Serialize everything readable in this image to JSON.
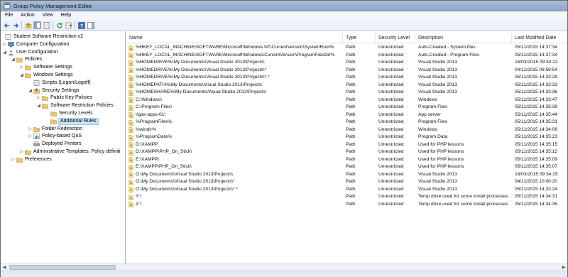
{
  "window": {
    "title": "Group Policy Management Editor"
  },
  "menu": [
    "File",
    "Action",
    "View",
    "Help"
  ],
  "colors": {
    "accent": "#2f6fb3",
    "folder": "#e8c66a",
    "selection": "#cce4f7"
  },
  "tree": [
    {
      "label": "Student Software Restriction v2",
      "icon": "gpo-icon",
      "exp": ""
    },
    {
      "label": "Computer Configuration",
      "icon": "computer-icon",
      "exp": "▷"
    },
    {
      "label": "User Configuration",
      "icon": "user-icon",
      "exp": "◢"
    },
    {
      "label": "Policies",
      "icon": "folder-icon",
      "exp": "◢"
    },
    {
      "label": "Software Settings",
      "icon": "folder-icon",
      "exp": "▷"
    },
    {
      "label": "Windows Settings",
      "icon": "folder-icon",
      "exp": "◢"
    },
    {
      "label": "Scripts (Logon/Logoff)",
      "icon": "script-icon",
      "exp": ""
    },
    {
      "label": "Security Settings",
      "icon": "security-icon",
      "exp": "◢"
    },
    {
      "label": "Public Key Policies",
      "icon": "folder-icon",
      "exp": "▷"
    },
    {
      "label": "Software Restriction Policies",
      "icon": "folder-icon",
      "exp": "◢"
    },
    {
      "label": "Security Levels",
      "icon": "folder-icon",
      "exp": ""
    },
    {
      "label": "Additional Rules",
      "icon": "folder-icon",
      "exp": "",
      "selected": true
    },
    {
      "label": "Folder Redirection",
      "icon": "folder-icon",
      "exp": "▷"
    },
    {
      "label": "Policy-based QoS",
      "icon": "chart-icon",
      "exp": "▷"
    },
    {
      "label": "Deployed Printers",
      "icon": "printer-icon",
      "exp": ""
    },
    {
      "label": "Administrative Templates: Policy definiti",
      "icon": "folder-icon",
      "exp": "▷"
    },
    {
      "label": "Preferences",
      "icon": "folder-icon",
      "exp": "▷"
    }
  ],
  "columns": [
    "Name",
    "Type",
    "Security Level",
    "Description",
    "Last Modified Date"
  ],
  "rows": [
    {
      "name": "%HKEY_LOCAL_MACHINE\\SOFTWARE\\Microsoft\\Windows NT\\CurrentVersion\\SystemRoot%",
      "type": "Path",
      "level": "Unrestricted",
      "desc": "Auto-Created - System files",
      "date": "05/11/2015 14:37:34"
    },
    {
      "name": "%HKEY_LOCAL_MACHINE\\SOFTWARE\\Microsoft\\Windows\\CurrentVersion\\ProgramFilesDir%",
      "type": "Path",
      "level": "Unrestricted",
      "desc": "Auto-Created - Program Files",
      "date": "05/11/2015 14:37:34"
    },
    {
      "name": "%HOMEDRIVE%\\My Documents\\Visual Studio 2013\\Projects\\",
      "type": "Path",
      "level": "Unrestricted",
      "desc": "Visual Studio 2013",
      "date": "16/03/2015 09:34:22"
    },
    {
      "name": "%HOMEDRIVE%\\My Documents\\Visual Studio 2013\\Projects\\*",
      "type": "Path",
      "level": "Unrestricted",
      "desc": "Visual Studio 2013",
      "date": "04/11/2015 09:59:54"
    },
    {
      "name": "%HOMEDRIVE%\\My Documents\\Visual Studio 2013\\Projects\\*.*",
      "type": "Path",
      "level": "Unrestricted",
      "desc": "Visual Studio 2013",
      "date": "05/11/2015 14:33:28"
    },
    {
      "name": "%HOMEPATH%\\My Documents\\Visual Studio 2013\\Projects\\",
      "type": "Path",
      "level": "Unrestricted",
      "desc": "Visual Studio 2013",
      "date": "05/11/2015 14:33:33"
    },
    {
      "name": "%HOMESHARE%\\My Documents\\Visual Studio 2013\\Projects\\",
      "type": "Path",
      "level": "Unrestricted",
      "desc": "Visual Studio 2013",
      "date": "05/11/2015 14:33:36"
    },
    {
      "name": "C:\\Windows\\",
      "type": "Path",
      "level": "Unrestricted",
      "desc": "Windows",
      "date": "05/11/2015 14:33:47"
    },
    {
      "name": "C:\\Program Files\\",
      "type": "Path",
      "level": "Unrestricted",
      "desc": "Program Files",
      "date": "05/11/2015 14:35:39"
    },
    {
      "name": "\\\\gas-apps-01\\",
      "type": "Path",
      "level": "Unrestricted",
      "desc": "App server",
      "date": "05/11/2015 14:35:44"
    },
    {
      "name": "%ProgramFiles%",
      "type": "Path",
      "level": "Unrestricted",
      "desc": "Program Files",
      "date": "05/11/2015 14:35:31"
    },
    {
      "name": "%windir%",
      "type": "Path",
      "level": "Unrestricted",
      "desc": "Windows",
      "date": "05/11/2015 14:34:09"
    },
    {
      "name": "%ProgramData%",
      "type": "Path",
      "level": "Unrestricted",
      "desc": "Program Data",
      "date": "05/11/2015 14:35:23"
    },
    {
      "name": "D:\\XAMPP",
      "type": "Path",
      "level": "Unrestricted",
      "desc": "Used for PHP lessons",
      "date": "05/11/2015 14:35:15"
    },
    {
      "name": "D:\\XAMPP\\PHP_On_Stick\\",
      "type": "Path",
      "level": "Unrestricted",
      "desc": "Used for PHP lessons",
      "date": "05/11/2015 14:35:12"
    },
    {
      "name": "E:\\XAMPP\\",
      "type": "Path",
      "level": "Unrestricted",
      "desc": "Used for PHP lessons",
      "date": "05/11/2015 14:35:09"
    },
    {
      "name": "E:\\XAMPP\\PHP_On_Stick\\",
      "type": "Path",
      "level": "Unrestricted",
      "desc": "Used for PHP lessons",
      "date": "05/11/2015 14:35:07"
    },
    {
      "name": "O:\\My Documents\\Visual Studio 2013\\Projects\\",
      "type": "Path",
      "level": "Unrestricted",
      "desc": "Visual Studio 2013",
      "date": "16/03/2015 09:34:15"
    },
    {
      "name": "O:\\My Documents\\Visual Studio 2013\\Projects\\*",
      "type": "Path",
      "level": "Unrestricted",
      "desc": "Visual Studio 2013",
      "date": "04/11/2015 10:00:20"
    },
    {
      "name": "O:\\My Documents\\Visual Studio 2013\\Projects\\*.*",
      "type": "Path",
      "level": "Unrestricted",
      "desc": "Visual Studio 2013",
      "date": "05/11/2015 14:33:24"
    },
    {
      "name": "Y:\\",
      "type": "Path",
      "level": "Unrestricted",
      "desc": "Temp drive used for some install processes",
      "date": "05/11/2015 14:34:31"
    },
    {
      "name": "Z:\\",
      "type": "Path",
      "level": "Unrestricted",
      "desc": "Temp drive used for some install processes",
      "date": "05/11/2015 14:34:35"
    }
  ]
}
